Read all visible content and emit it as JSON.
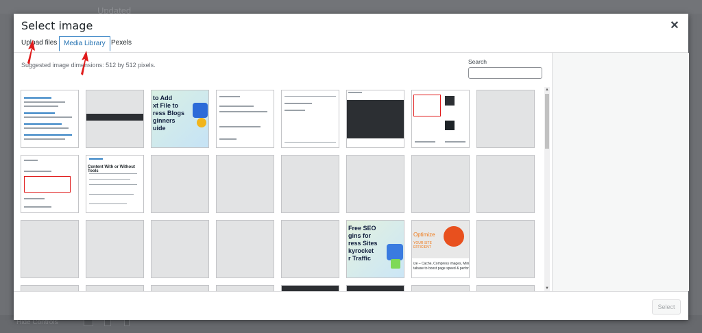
{
  "background": {
    "top_text": "Updated",
    "hide_controls": "Hide Controls"
  },
  "modal": {
    "title": "Select image",
    "close_icon": "close-icon",
    "tabs": [
      {
        "label": "Upload files"
      },
      {
        "label": "Media Library"
      },
      {
        "label": "Pexels"
      }
    ],
    "hint": "Suggested image dimensions: 512 by 512 pixels.",
    "search": {
      "label": "Search",
      "value": "",
      "placeholder": ""
    },
    "thumbs": {
      "t3": [
        "to Add",
        "xt File to",
        "ress Blogs",
        "ginners",
        "uide"
      ],
      "t4": "Content With or Without Tools",
      "t5": [
        "Free SEO",
        "gins for",
        "ress Sites",
        "kyrocket",
        "r Traffic"
      ],
      "t6": "Optimize",
      "t6b": "YOUR SITE",
      "t6c": "EFFICIENT",
      "t6d": "ize – Cache, Compress images, Mini",
      "t6e": "tabase to boost page speed & perfor"
    },
    "select_label": "Select"
  },
  "colors": {
    "accent": "#2271b1",
    "arrow": "#e01b1b"
  }
}
